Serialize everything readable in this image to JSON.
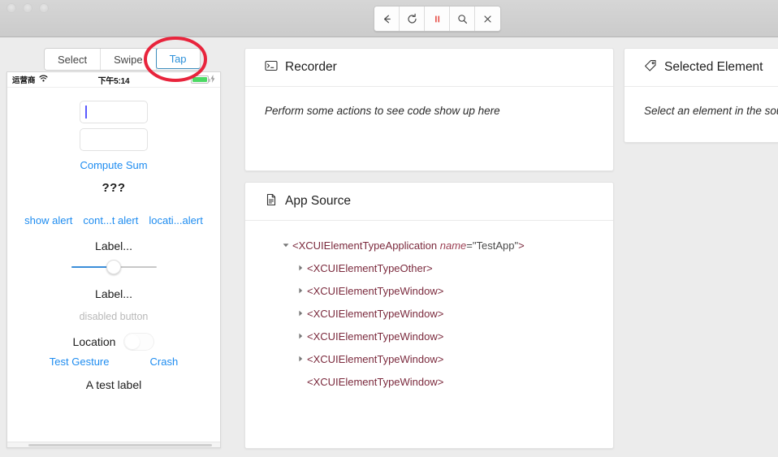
{
  "window": {
    "traffic_lights": [
      "close",
      "minimize",
      "zoom"
    ]
  },
  "toolbar": {
    "buttons": [
      {
        "name": "back-button",
        "icon": "back-arrow-icon",
        "glyph": "←"
      },
      {
        "name": "refresh-button",
        "icon": "refresh-icon",
        "glyph": "↻"
      },
      {
        "name": "pause-button",
        "icon": "pause-icon",
        "glyph": "❙❙",
        "color": "#e8564f"
      },
      {
        "name": "search-button",
        "icon": "search-icon",
        "glyph": "⌕"
      },
      {
        "name": "close-button",
        "icon": "close-icon",
        "glyph": "✕"
      }
    ]
  },
  "tabs": {
    "items": [
      {
        "label": "Select",
        "active": false
      },
      {
        "label": "Swipe",
        "active": false
      },
      {
        "label": "Tap",
        "active": true
      }
    ],
    "active_label": "Tap",
    "annotation_color": "#e8243c",
    "active_color": "#2b90d9"
  },
  "device": {
    "status_bar": {
      "carrier": "运营商",
      "wifi_icon": "wifi-icon",
      "time": "下午5:14",
      "battery_icon": "battery-icon",
      "charging_icon": "charging-bolt-icon",
      "battery_color": "#4cd964"
    },
    "text_field_1_value": "",
    "text_field_2_value": "",
    "compute_sum_label": "Compute Sum",
    "sum_result": "???",
    "alert_buttons": [
      "show alert",
      "cont...t alert",
      "locati...alert"
    ],
    "label_top": "Label...",
    "slider_value_percent": 50,
    "label_bottom": "Label...",
    "disabled_button_label": "disabled button",
    "location_label": "Location",
    "location_switch_on": false,
    "test_gesture_label": "Test Gesture",
    "crash_label": "Crash",
    "test_label": "A test label",
    "link_color": "#1e8cf0"
  },
  "recorder": {
    "icon": "terminal-icon",
    "title": "Recorder",
    "placeholder": "Perform some actions to see code show up here"
  },
  "app_source": {
    "icon": "document-icon",
    "title": "App Source",
    "tree": [
      {
        "depth": 0,
        "arrow": "expanded",
        "tag_open": "<XCUIElementTypeApplication ",
        "attr": "name",
        "eq": "=",
        "value": "\"TestApp\"",
        "tag_close": ">"
      },
      {
        "depth": 1,
        "arrow": "collapsed",
        "tag_open": "<XCUIElementTypeOther>",
        "attr": "",
        "eq": "",
        "value": "",
        "tag_close": ""
      },
      {
        "depth": 1,
        "arrow": "collapsed",
        "tag_open": "<XCUIElementTypeWindow>",
        "attr": "",
        "eq": "",
        "value": "",
        "tag_close": ""
      },
      {
        "depth": 1,
        "arrow": "collapsed",
        "tag_open": "<XCUIElementTypeWindow>",
        "attr": "",
        "eq": "",
        "value": "",
        "tag_close": ""
      },
      {
        "depth": 1,
        "arrow": "collapsed",
        "tag_open": "<XCUIElementTypeWindow>",
        "attr": "",
        "eq": "",
        "value": "",
        "tag_close": ""
      },
      {
        "depth": 1,
        "arrow": "collapsed",
        "tag_open": "<XCUIElementTypeWindow>",
        "attr": "",
        "eq": "",
        "value": "",
        "tag_close": ""
      },
      {
        "depth": 1,
        "arrow": "none",
        "tag_open": "<XCUIElementTypeWindow>",
        "attr": "",
        "eq": "",
        "value": "",
        "tag_close": ""
      }
    ]
  },
  "selected_element": {
    "icon": "tag-icon",
    "title": "Selected Element",
    "placeholder": "Select an element in the source"
  }
}
